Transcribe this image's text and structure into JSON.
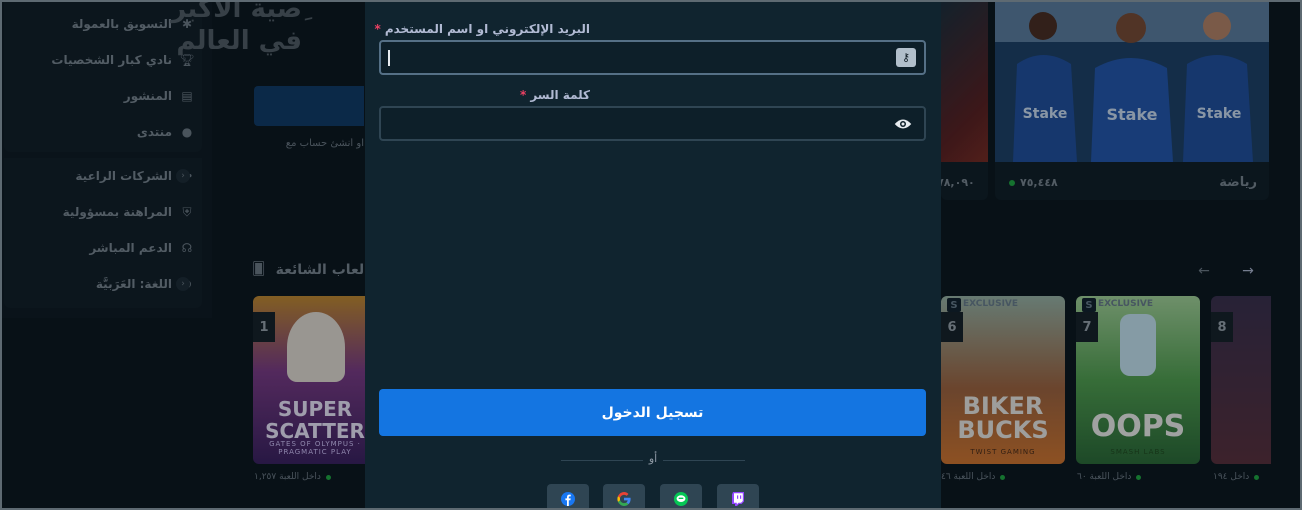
{
  "sidebar": {
    "items": [
      {
        "label": "التسويق بالعمولة",
        "icon": "affiliate-icon"
      },
      {
        "label": "نادي كبار الشخصيات",
        "icon": "trophy-icon"
      },
      {
        "label": "المنشور",
        "icon": "newspaper-icon"
      },
      {
        "label": "منتدى",
        "icon": "chat-bubble-icon"
      },
      {
        "label": "الشركات الراعية",
        "icon": "sponsorship-icon"
      },
      {
        "label": "المراهنة بمسؤولية",
        "icon": "shield-icon"
      },
      {
        "label": "الدعم المباشر",
        "icon": "headset-icon"
      },
      {
        "label": "اللغة: العَرَبيَّة",
        "icon": "globe-icon"
      }
    ]
  },
  "hero": {
    "title_line1": "ِصية الأكبر",
    "title_line2": "في العالم",
    "register_sub": "او أنشئ حساب مع"
  },
  "top_cards": [
    {
      "name": "",
      "count": "٧٨,٠٩٠"
    },
    {
      "name": "رياضة",
      "count": "٧٥,٤٤٨"
    }
  ],
  "trending": {
    "title": "ألعاب الشائعة",
    "games": [
      {
        "rank": "1",
        "title": "SUPER SCATTER",
        "subtitle": "GATES OF OLYMPUS · PRAGMATIC PLAY",
        "players": "داخل اللعبة ١,٢٥٧"
      },
      {
        "rank": "6",
        "title": "BIKER BUCKS",
        "subtitle": "TWIST GAMING",
        "players": "داخل اللعبة ٤٦",
        "badge": "EXCLUSIVE"
      },
      {
        "rank": "7",
        "title": "OOPS",
        "subtitle": "SMASH LABS",
        "players": "داخل اللعبة ٦٠",
        "badge": "EXCLUSIVE"
      },
      {
        "rank": "8",
        "title": "",
        "subtitle": "",
        "players": "داخل ١٩٤"
      }
    ]
  },
  "login_modal": {
    "email_label": "البريد الإلكتروني او اسم المستخدم",
    "required_mark": "*",
    "email_value": "",
    "password_label": "كلمة السر",
    "password_value": "",
    "submit_label": "تسجيل الدخول",
    "or_text": "أو",
    "social": [
      {
        "name": "facebook-icon",
        "color": "#1877f2"
      },
      {
        "name": "google-icon",
        "color": "#ea4335"
      },
      {
        "name": "line-icon",
        "color": "#06c755"
      },
      {
        "name": "twitch-icon",
        "color": "#9146ff"
      }
    ]
  },
  "colors": {
    "primary_button": "#1475e1",
    "modal_bg": "#10242f",
    "input_border": "#2f4553",
    "required": "#ed4163",
    "online": "#1ea93f"
  }
}
